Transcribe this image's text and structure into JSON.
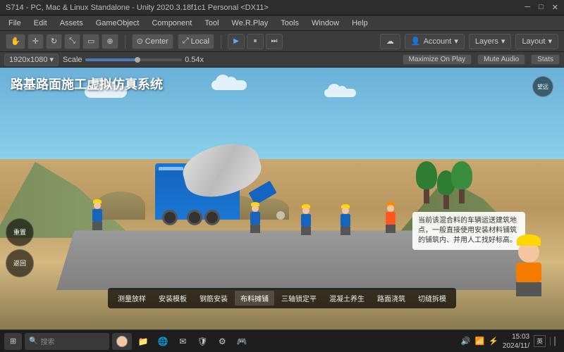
{
  "titlebar": {
    "text": "S714 - PC, Mac & Linux Standalone - Unity 2020.3.18f1c1 Personal <DX11>"
  },
  "menubar": {
    "items": [
      "File",
      "Edit",
      "Assets",
      "GameObject",
      "Component",
      "Tool",
      "We.R.Play",
      "Tools",
      "Window",
      "Help"
    ]
  },
  "toolbar": {
    "transform_tools": [
      "hand",
      "move",
      "rotate",
      "scale",
      "rect",
      "combo"
    ],
    "pivot_center": "Center",
    "pivot_local": "Local",
    "play": "▶",
    "pause": "⏸",
    "step": "⏭",
    "account": "Account",
    "layers": "Layers",
    "layout": "Layout",
    "cloud_icon": "☁"
  },
  "scene_toolbar": {
    "resolution": "1920x1080",
    "scale_label": "Scale",
    "scale_value": "0.54x",
    "maximize_on_play": "Maximize On Play",
    "mute_audio": "Mute Audio",
    "stats": "Stats"
  },
  "viewport": {
    "title": "路基路面施工虚拟仿真系统",
    "compass_label": "望远",
    "dialog_text": "当前该混合料的车辆运送建筑地点，一般直接使用安装材料铺筑的铺筑内、并用人工找好标高。",
    "guide_label": ""
  },
  "bottom_menu": {
    "items": [
      "测量放样",
      "安装模板",
      "钢筋安装",
      "布料摊铺",
      "三轴锁定平",
      "混凝土养生",
      "路面浇筑",
      "切缝拆模"
    ]
  },
  "left_controls": {
    "buttons": [
      "重置",
      "返回"
    ]
  },
  "taskbar": {
    "search_placeholder": "搜索",
    "time": "15:03",
    "date": "2024/11/",
    "apps": [
      "🪟",
      "📁",
      "🌐",
      "📧",
      "🛡️",
      "🎮"
    ],
    "sys_icons": [
      "🔊",
      "📶",
      "⚡"
    ]
  }
}
